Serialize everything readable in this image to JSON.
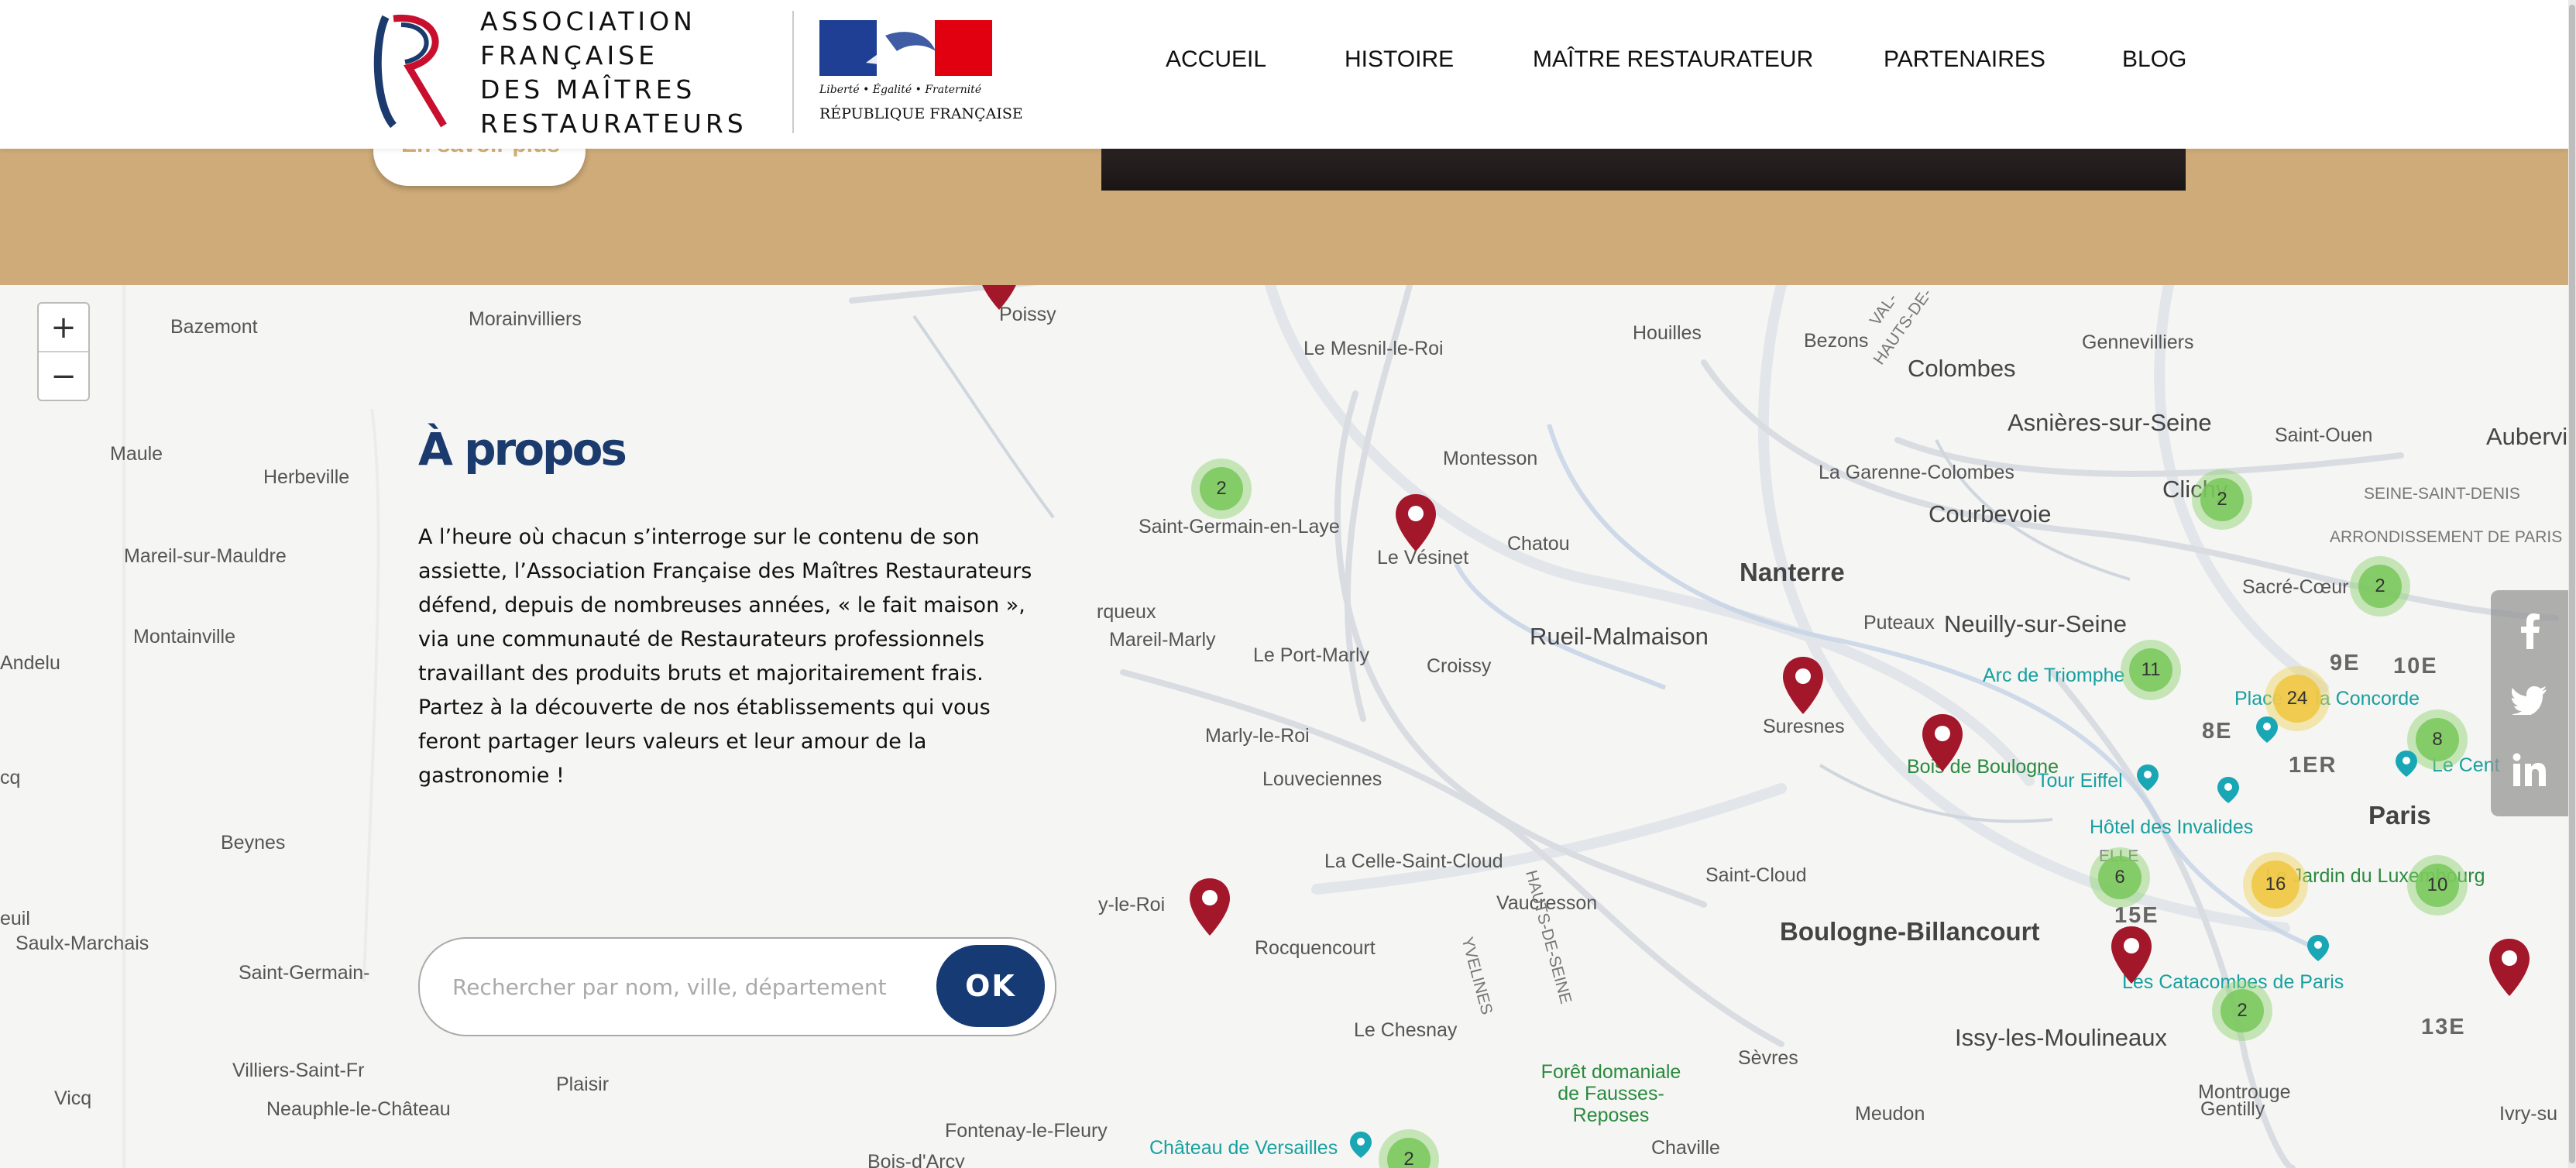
{
  "header": {
    "logo_lines": [
      "ASSOCIATION",
      "FRANÇAISE",
      "DES MAÎTRES",
      "RESTAURATEURS"
    ],
    "rf_motto": "Liberté • Égalité • Fraternité",
    "rf_name": "RÉPUBLIQUE FRANÇAISE",
    "nav": [
      "ACCUEIL",
      "HISTOIRE",
      "MAÎTRE RESTAURATEUR",
      "PARTENAIRES",
      "BLOG"
    ]
  },
  "banner": {
    "button_label": "En savoir plus"
  },
  "map": {
    "zoom_in": "+",
    "zoom_out": "−",
    "places": [
      "Bazemont",
      "Morainvilliers",
      "Poissy",
      "Le Mesnil-le-Roi",
      "Houilles",
      "Bezons",
      "Colombes",
      "Gennevilliers",
      "Maule",
      "Herbeville",
      "Asnières-sur-Seine",
      "Saint-Ouen",
      "Aubervil",
      "Montesson",
      "La Garenne-Colombes",
      "Clichy",
      "SEINE-SAINT-DENIS",
      "Saint-Germain-en-Laye",
      "Chatou",
      "Courbevoie",
      "ARRONDISSEMENT DE PARIS",
      "Mareil-sur-Mauldre",
      "Le Vésinet",
      "Nanterre",
      "Sacré-Cœur",
      "rqueux",
      "Mareil-Marly",
      "Le Port-Marly",
      "Rueil-Malmaison",
      "Puteaux",
      "Neuilly-sur-Seine",
      "Montainville",
      "Croissy",
      "Arc de Triomphe",
      "9E",
      "10E",
      "Andelu",
      "Place de la Concorde",
      "Suresnes",
      "8E",
      "Marly-le-Roi",
      "Bois de Boulogne",
      "1ER",
      "Le Cent",
      "cq",
      "Louveciennes",
      "Tour Eiffel",
      "Paris",
      "Beynes",
      "Hôtel des Invalides",
      "La Celle-Saint-Cloud",
      "Saint-Cloud",
      "Le Jardin du Luxembourg",
      "Vaucresson",
      "euil",
      "y-le-Roi",
      "Saulx-Marchais",
      "Boulogne-Billancourt",
      "15E",
      "Saint-Germain-",
      "Rocquencourt",
      "Les Catacombes de Paris",
      "Le Chesnay",
      "Issy-les-Moulineaux",
      "13E",
      "Villiers-Saint-Fr",
      "Sèvres",
      "Forêt domaniale de Fausses-Reposes",
      "Plaisir",
      "Montrouge",
      "Vicq",
      "Neauphle-le-Château",
      "Meudon",
      "Gentilly",
      "Ivry-su",
      "Fontenay-le-Fleury",
      "Château de Versailles",
      "Chaville",
      "Bois-d'Arcy",
      "VAL-",
      "HAUTS-DE-",
      "YVELINES",
      "HAUTS-DE-SEINE",
      "ELLE"
    ],
    "clusters": [
      "2",
      "2",
      "2",
      "11",
      "24",
      "8",
      "6",
      "16",
      "10",
      "2",
      "2"
    ]
  },
  "about": {
    "title": "À propos",
    "paragraph": "A l’heure où chacun s’interroge sur le contenu de son assiette, l’Association Française des Maîtres Restaurateurs défend, depuis de nombreuses années, « le fait maison », via une communauté de Restaurateurs professionnels travaillant des produits bruts et majoritairement frais.",
    "paragraph2": "Partez à la découverte de nos établissements qui vous feront partager leurs valeurs et leur amour de la gastronomie !"
  },
  "search": {
    "placeholder": "Rechercher par nom, ville, département...",
    "button": "OK"
  },
  "social": [
    "facebook-icon",
    "twitter-icon",
    "linkedin-icon"
  ],
  "colors": {
    "brand_blue": "#163a73",
    "banner_gold": "#ceab78",
    "pin_red": "#a3172a",
    "cluster_green": "#8fd26f",
    "cluster_yellow": "#f0c846"
  }
}
